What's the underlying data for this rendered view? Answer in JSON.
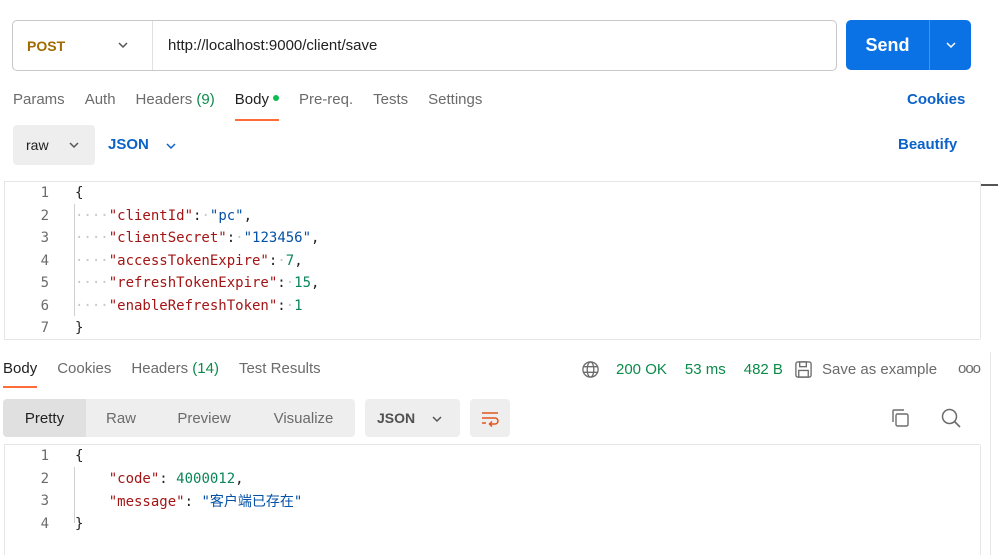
{
  "request": {
    "method": "POST",
    "url": "http://localhost:9000/client/save",
    "send_label": "Send"
  },
  "request_tabs": [
    {
      "label": "Params"
    },
    {
      "label": "Auth"
    },
    {
      "label": "Headers",
      "count": "(9)"
    },
    {
      "label": "Body",
      "active": true,
      "dot_color": "#0cbb52"
    },
    {
      "label": "Pre-req."
    },
    {
      "label": "Tests"
    },
    {
      "label": "Settings"
    }
  ],
  "cookies_label": "Cookies",
  "body_options": {
    "mode": "raw",
    "language": "JSON",
    "beautify_label": "Beautify"
  },
  "request_body_lines": [
    {
      "n": "1",
      "text": "{"
    },
    {
      "n": "2",
      "key": "\"clientId\"",
      "value": "\"pc\"",
      "vtype": "str",
      "trail": ","
    },
    {
      "n": "3",
      "key": "\"clientSecret\"",
      "value": "\"123456\"",
      "vtype": "str",
      "trail": ","
    },
    {
      "n": "4",
      "key": "\"accessTokenExpire\"",
      "value": "7",
      "vtype": "num",
      "trail": ","
    },
    {
      "n": "5",
      "key": "\"refreshTokenExpire\"",
      "value": "15",
      "vtype": "num",
      "trail": ","
    },
    {
      "n": "6",
      "key": "\"enableRefreshToken\"",
      "value": "1",
      "vtype": "num",
      "trail": ""
    },
    {
      "n": "7",
      "text": "}"
    }
  ],
  "response_tabs": [
    {
      "label": "Body",
      "active": true
    },
    {
      "label": "Cookies"
    },
    {
      "label": "Headers",
      "count": "(14)"
    },
    {
      "label": "Test Results"
    }
  ],
  "response_status": {
    "status": "200 OK",
    "time": "53 ms",
    "size": "482 B",
    "save_label": "Save as example",
    "more_label": "ooo"
  },
  "response_view": {
    "modes": [
      "Pretty",
      "Raw",
      "Preview",
      "Visualize"
    ],
    "active_mode": "Pretty",
    "format": "JSON"
  },
  "response_body_lines": [
    {
      "n": "1",
      "text": "{"
    },
    {
      "n": "2",
      "key": "\"code\"",
      "value": "4000012",
      "vtype": "num",
      "trail": ","
    },
    {
      "n": "3",
      "key": "\"message\"",
      "value": "\"客户端已存在\"",
      "vtype": "str",
      "trail": ""
    },
    {
      "n": "4",
      "text": "}"
    }
  ],
  "colors": {
    "accent": "#ff6c37",
    "send_button": "#0b72e6",
    "link": "#0b62c8",
    "status_ok": "#0c8a4a",
    "method_post": "#a06a00"
  },
  "icons": [
    "chevron-down-icon",
    "globe-icon",
    "save-icon",
    "wrap-lines-icon",
    "copy-icon",
    "search-icon"
  ]
}
